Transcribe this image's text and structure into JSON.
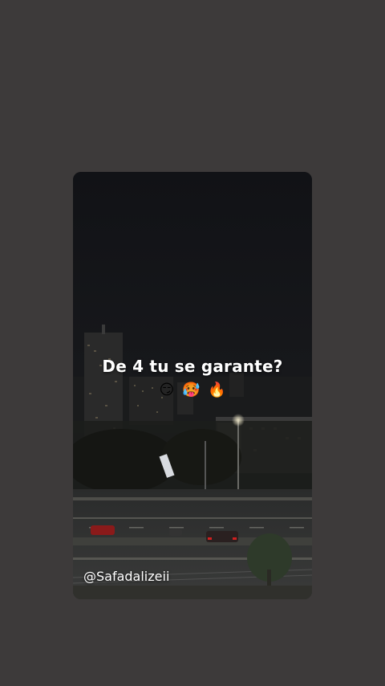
{
  "story": {
    "caption": "De 4 tu se garante?",
    "emojis": [
      "😏",
      "🥵",
      "🔥"
    ],
    "username": "@Safadalizeii"
  },
  "colors": {
    "outer_background": "#3d3a3a",
    "sky": "#121316",
    "text": "#ffffff"
  }
}
